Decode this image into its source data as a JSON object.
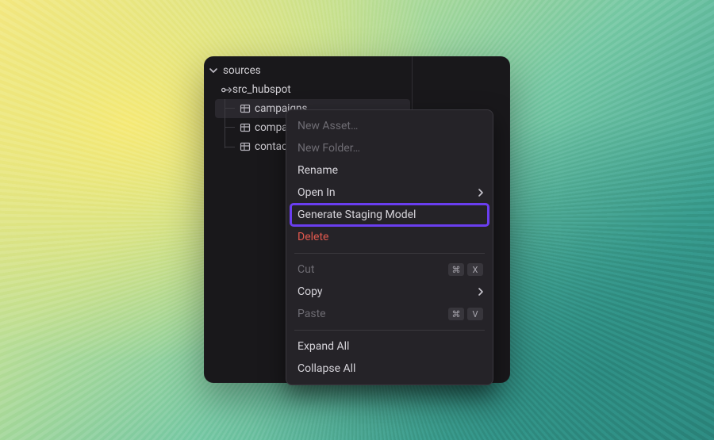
{
  "tree": {
    "root_label": "sources",
    "source_label": "src_hubspot",
    "tables": [
      "campaigns",
      "compa",
      "contac"
    ]
  },
  "menu": {
    "new_asset": "New Asset…",
    "new_folder": "New Folder…",
    "rename": "Rename",
    "open_in": "Open In",
    "generate_staging": "Generate Staging Model",
    "delete": "Delete",
    "cut": "Cut",
    "copy": "Copy",
    "paste": "Paste",
    "expand_all": "Expand All",
    "collapse_all": "Collapse All",
    "cut_key": "X",
    "paste_key": "V",
    "cmd_symbol": "⌘"
  },
  "icons": {
    "chevron_down": "chevron-down",
    "source_node": "source-node",
    "table": "table",
    "chevron_right": "chevron-right"
  },
  "colors": {
    "highlight_border": "#6a3ef0",
    "panel_bg": "#19181b",
    "menu_bg": "#252328",
    "danger": "#e0584e"
  }
}
